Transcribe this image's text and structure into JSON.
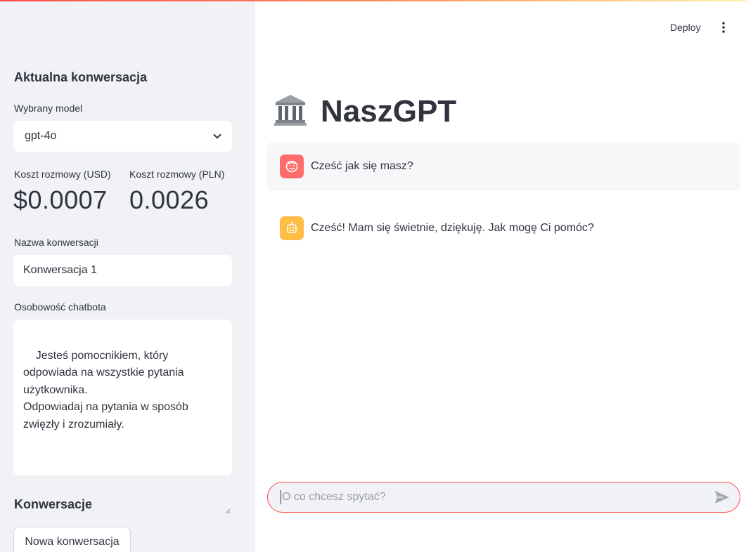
{
  "header": {
    "deploy_label": "Deploy",
    "menu_icon": "kebab-menu-icon",
    "accent_gradient": [
      "#ff4b4b",
      "#ff8a5c",
      "#fff2a8"
    ]
  },
  "sidebar": {
    "current_conversation_title": "Aktualna konwersacja",
    "model_label": "Wybrany model",
    "model_value": "gpt-4o",
    "cost_usd_label": "Koszt rozmowy (USD)",
    "cost_usd_value": "$0.0007",
    "cost_pln_label": "Koszt rozmowy (PLN)",
    "cost_pln_value": "0.0026",
    "conversation_name_label": "Nazwa konwersacji",
    "conversation_name_value": "Konwersacja 1",
    "personality_label": "Osobowość chatbota",
    "personality_value": "Jesteś pomocnikiem, który\nodpowiada na wszystkie pytania\nużytkownika.\nOdpowiadaj na pytania w sposób\nzwięzły i zrozumiały.",
    "conversations_title": "Konwersacje",
    "new_conversation_label": "Nowa konwersacja"
  },
  "main": {
    "title_icon": "classical-building-icon",
    "title": "NaszGPT",
    "messages": [
      {
        "role": "user",
        "avatar_icon": "user-face-icon",
        "avatar_color": "#ff6c6c",
        "text": "Cześć jak się masz?"
      },
      {
        "role": "assistant",
        "avatar_icon": "robot-icon",
        "avatar_color": "#ffbd45",
        "text": "Cześć! Mam się świetnie, dziękuję. Jak mogę Ci pomóc?"
      }
    ],
    "chat_input_placeholder": "O co chcesz spytać?",
    "send_icon": "send-arrow-icon",
    "input_border_color": "#ff4b4b"
  }
}
